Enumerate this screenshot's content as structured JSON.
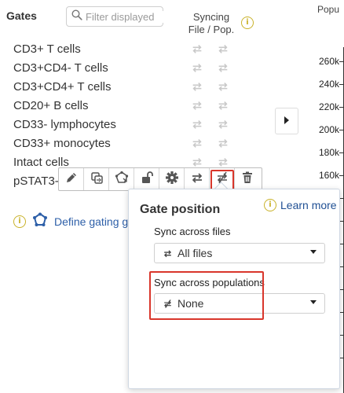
{
  "header": {
    "gates_title": "Gates",
    "search_placeholder": "Filter displayed",
    "syncing_line1": "Syncing",
    "syncing_line2": "File / Pop.",
    "info_symbol": "i",
    "pop_header": "Popu"
  },
  "gates": [
    {
      "label": "CD3+ T cells"
    },
    {
      "label": "CD3+CD4- T cells"
    },
    {
      "label": "CD3+CD4+ T cells"
    },
    {
      "label": "CD20+ B cells"
    },
    {
      "label": "CD33- lymphocytes"
    },
    {
      "label": "CD33+ monocytes"
    },
    {
      "label": "Intact cells"
    },
    {
      "label": "pSTAT3-"
    }
  ],
  "y_axis": {
    "ticks": [
      "260k",
      "240k",
      "220k",
      "200k",
      "180k",
      "160k"
    ]
  },
  "toolbar": {
    "buttons": [
      "edit-icon",
      "copy-gate-icon",
      "polygon-icon",
      "unlock-icon",
      "settings-icon",
      "sync-files-icon",
      "sync-populations-off-icon",
      "delete-icon"
    ],
    "highlighted": "sync-populations-off-icon"
  },
  "define_gating": {
    "info_symbol": "i",
    "label": "Define gating g"
  },
  "popover": {
    "title": "Gate position",
    "learn_more": "Learn more",
    "files_label": "Sync across files",
    "files_value": "All files",
    "populations_label": "Sync across populations",
    "populations_value": "None"
  },
  "colors": {
    "accent_red": "#d9362b",
    "link_blue": "#1f4f93",
    "info_yellow": "#c9b22a"
  }
}
